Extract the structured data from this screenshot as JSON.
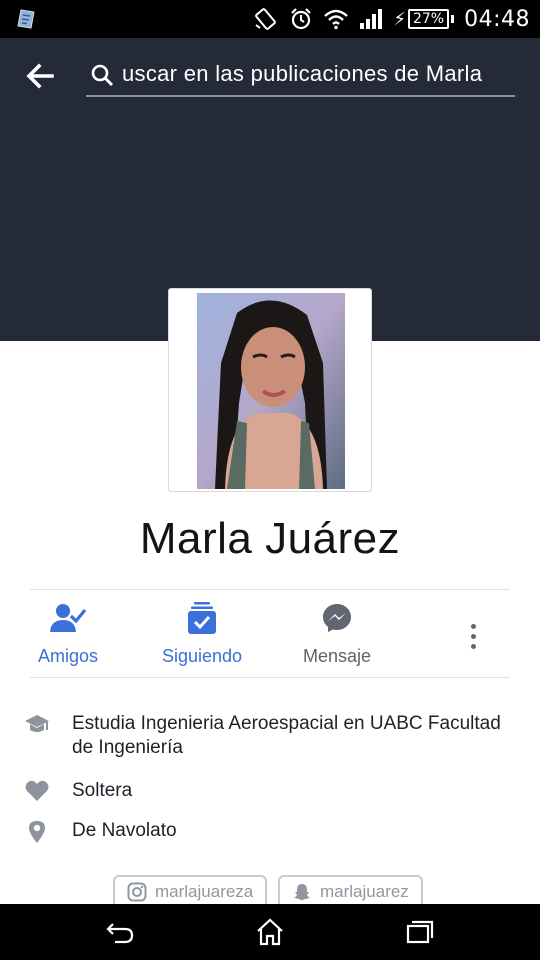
{
  "status_bar": {
    "time": "04:48",
    "battery_percent": "27%",
    "icons": [
      "app-icon",
      "rotation-icon",
      "alarm-icon",
      "wifi-icon",
      "signal-icon",
      "charging-icon",
      "battery-icon"
    ]
  },
  "header": {
    "search_text": "uscar en las publicaciones de Marla",
    "back_icon": "back-arrow-icon",
    "search_icon": "search-icon",
    "cover_color": "#252a38"
  },
  "profile": {
    "name": "Marla Juárez"
  },
  "actions": [
    {
      "label": "Amigos",
      "icon": "friends-check-icon",
      "color": "#3b6fd9"
    },
    {
      "label": "Siguiendo",
      "icon": "following-icon",
      "color": "#3b6fd9"
    },
    {
      "label": "Mensaje",
      "icon": "messenger-icon",
      "color": "#5f6368"
    }
  ],
  "info": [
    {
      "icon": "graduation-cap-icon",
      "text": "Estudia Ingenieria  Aeroespacial en UABC Facultad de Ingeniería"
    },
    {
      "icon": "heart-icon",
      "text": "Soltera"
    },
    {
      "icon": "location-pin-icon",
      "text": "De Navolato"
    }
  ],
  "social": [
    {
      "icon": "instagram-icon",
      "handle": "marlajuareza"
    },
    {
      "icon": "snapchat-icon",
      "handle": "marlajuarez"
    }
  ],
  "accent_color": "#3b6fd9"
}
